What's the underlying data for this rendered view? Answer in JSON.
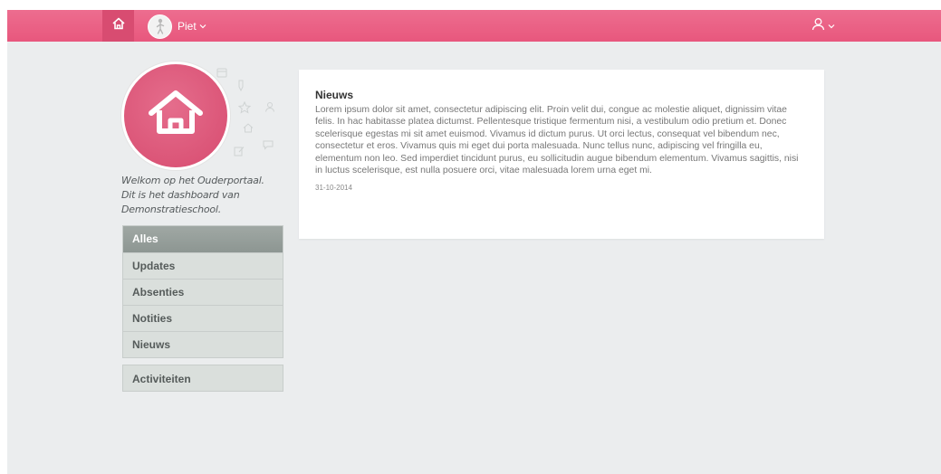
{
  "topbar": {
    "user_name": "Piet",
    "colors": {
      "bar": "#e8577d",
      "home_active": "#d84c71"
    },
    "icons": [
      "home-icon",
      "avatar",
      "chevron-down-icon",
      "user-icon"
    ]
  },
  "sidebar": {
    "welcome_lines": [
      "Welkom op het Ouderportaal.",
      "Dit is het dashboard van",
      "Demonstratieschool."
    ],
    "filters": [
      {
        "label": "Alles",
        "active": true
      },
      {
        "label": "Updates",
        "active": false
      },
      {
        "label": "Absenties",
        "active": false
      },
      {
        "label": "Notities",
        "active": false
      },
      {
        "label": "Nieuws",
        "active": false
      }
    ],
    "activities_label": "Activiteiten"
  },
  "news": {
    "title": "Nieuws",
    "body": "Lorem ipsum dolor sit amet, consectetur adipiscing elit. Proin velit dui, congue ac molestie aliquet, dignissim vitae felis. In hac habitasse platea dictumst. Pellentesque tristique fermentum nisi, a vestibulum odio pretium et. Donec scelerisque egestas mi sit amet euismod. Vivamus id dictum purus. Ut orci lectus, consequat vel bibendum nec, consectetur et eros. Vivamus quis mi eget dui porta malesuada. Nunc tellus nunc, adipiscing vel fringilla eu, elementum non leo. Sed imperdiet tincidunt purus, eu sollicitudin augue bibendum elementum. Vivamus sagittis, nisi in luctus scelerisque, est nulla posuere orci, vitae malesuada lorem urna eget mi.",
    "date": "31-10-2014"
  }
}
